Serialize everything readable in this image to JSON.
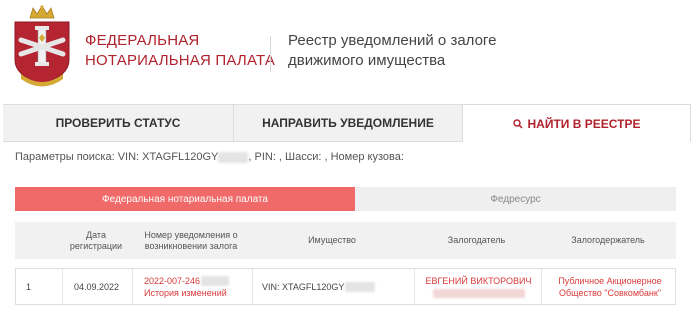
{
  "header": {
    "org_line1": "ФЕДЕРАЛЬНАЯ",
    "org_line2": "НОТАРИАЛЬНАЯ ПАЛАТА",
    "registry_line1": "Реестр уведомлений о залоге",
    "registry_line2": "движимого имущества"
  },
  "tabs": {
    "check_status": "ПРОВЕРИТЬ СТАТУС",
    "send_notice": "НАПРАВИТЬ УВЕДОМЛЕНИЕ",
    "find_in_registry": "НАЙТИ В РЕЕСТРЕ"
  },
  "search": {
    "params_prefix": "Параметры поиска: VIN: XTAGFL120GY",
    "params_suffix": ", PIN: , Шасси: , Номер кузова:"
  },
  "sources": {
    "active": "Федеральная нотариальная палата",
    "inactive": "Федресурс"
  },
  "table": {
    "columns": {
      "date_line1": "Дата",
      "date_line2": "регистрации",
      "number_line1": "Номер уведомления о",
      "number_line2": "возникновении залога",
      "property": "Имущество",
      "pledgor": "Залогодатель",
      "pledgee": "Залогодержатель"
    },
    "rows": [
      {
        "index": "1",
        "date": "04.09.2022",
        "number": "2022-007-246",
        "history_link": "История изменений",
        "property": "VIN: XTAGFL120GY",
        "pledgor": "ЕВГЕНИЙ ВИКТОРОВИЧ",
        "pledgee_line1": "Публичное Акционерное",
        "pledgee_line2": "Общество \"Совкомбанк\""
      }
    ]
  },
  "colors": {
    "brand_red": "#b0232d",
    "active_source_bg": "#f06a6a",
    "link_red": "#d93a3a"
  }
}
